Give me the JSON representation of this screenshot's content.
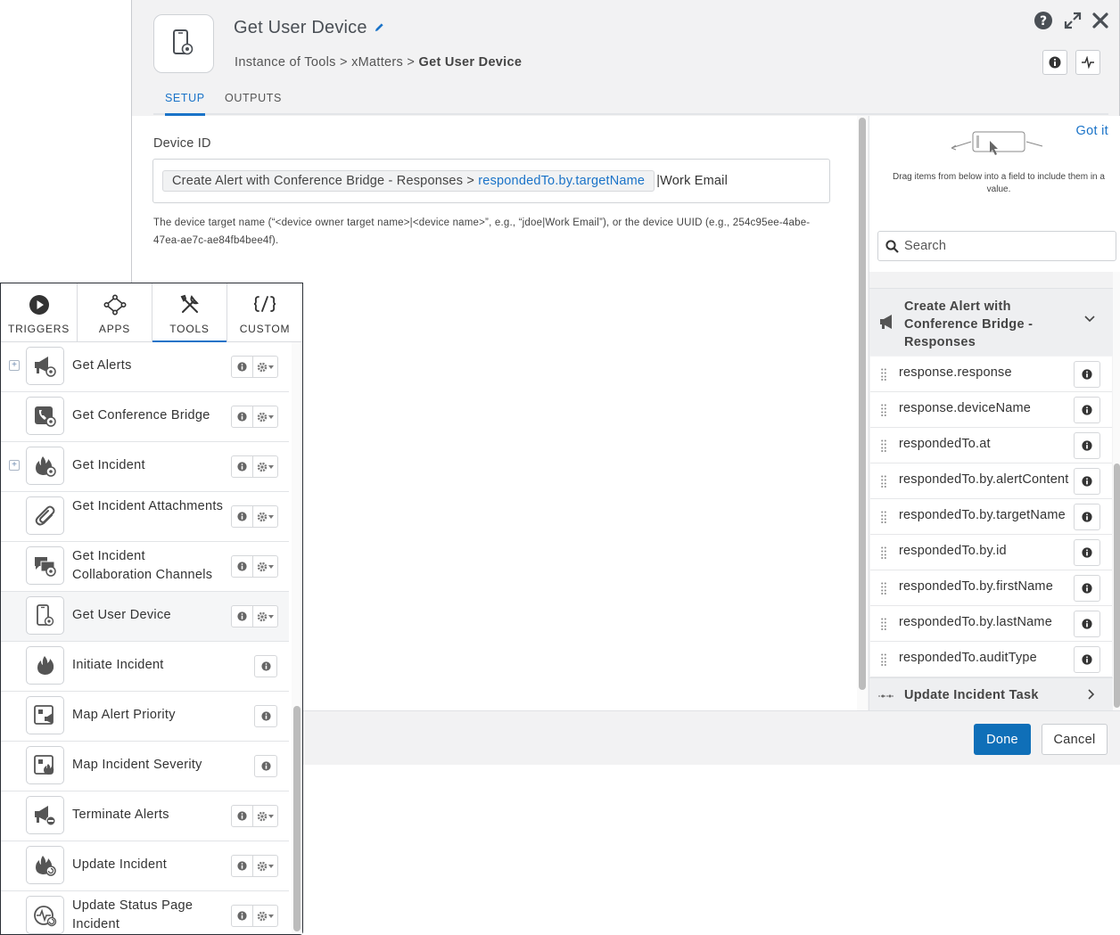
{
  "header": {
    "title": "Get User Device",
    "breadcrumb_prefix": "Instance of Tools > xMatters > ",
    "breadcrumb_current": "Get User Device"
  },
  "tabs": [
    {
      "label": "SETUP",
      "active": true
    },
    {
      "label": "OUTPUTS",
      "active": false
    }
  ],
  "setup": {
    "field_label": "Device ID",
    "pill_prefix": "Create Alert with Conference Bridge - Responses > ",
    "pill_link": "respondedTo.by.targetName",
    "field_suffix": "|Work Email",
    "help_text": "The device target name (“<device owner target name>|<device name>”, e.g., “jdoe|Work Email”), or the device UUID (e.g., 254c95ee-4abe-47ea-ae7c-ae84fb4bee4f)."
  },
  "right_panel": {
    "got_it": "Got it",
    "drag_hint": "Drag items from below into a field to include them in a value.",
    "search_placeholder": "Search",
    "group_title": "Create Alert with Conference Bridge - Responses",
    "properties": [
      "response.response",
      "response.deviceName",
      "respondedTo.at",
      "respondedTo.by.alertContent",
      "respondedTo.by.targetName",
      "respondedTo.by.id",
      "respondedTo.by.firstName",
      "respondedTo.by.lastName",
      "respondedTo.auditType"
    ],
    "next_group_title": "Update Incident Task"
  },
  "footer": {
    "done": "Done",
    "cancel": "Cancel"
  },
  "tool_panel": {
    "tabs": [
      {
        "label": "TRIGGERS",
        "icon": "play-circle-icon",
        "active": false
      },
      {
        "label": "APPS",
        "icon": "apps-network-icon",
        "active": false
      },
      {
        "label": "TOOLS",
        "icon": "tools-icon",
        "active": true
      },
      {
        "label": "CUSTOM",
        "icon": "code-icon",
        "active": false
      }
    ],
    "tools": [
      {
        "name": "Get Alerts",
        "icon": "megaphone-gear-icon",
        "expandable": true,
        "gear": true
      },
      {
        "name": "Get Conference Bridge",
        "icon": "phone-gear-icon",
        "expandable": false,
        "gear": true
      },
      {
        "name": "Get Incident",
        "icon": "flame-gear-icon",
        "expandable": true,
        "gear": true
      },
      {
        "name": "Get Incident Attachments",
        "icon": "paperclip-icon",
        "expandable": false,
        "gear": true
      },
      {
        "name": "Get Incident Collaboration Channels",
        "icon": "chat-gear-icon",
        "expandable": false,
        "gear": true
      },
      {
        "name": "Get User Device",
        "icon": "mobile-gear-icon",
        "expandable": false,
        "gear": true,
        "selected": true
      },
      {
        "name": "Initiate Incident",
        "icon": "flame-icon",
        "expandable": false,
        "gear": false
      },
      {
        "name": "Map Alert Priority",
        "icon": "map-megaphone-icon",
        "expandable": false,
        "gear": false
      },
      {
        "name": "Map Incident Severity",
        "icon": "map-flame-icon",
        "expandable": false,
        "gear": false
      },
      {
        "name": "Terminate Alerts",
        "icon": "megaphone-minus-icon",
        "expandable": false,
        "gear": true
      },
      {
        "name": "Update Incident",
        "icon": "flame-refresh-icon",
        "expandable": false,
        "gear": true
      },
      {
        "name": "Update Status Page Incident",
        "icon": "status-page-icon",
        "expandable": false,
        "gear": true
      }
    ]
  },
  "colors": {
    "accent": "#1a73c8",
    "done_button": "#0f6fb8"
  }
}
